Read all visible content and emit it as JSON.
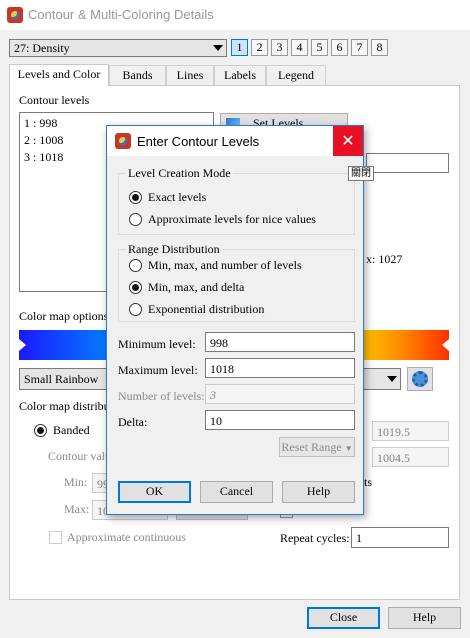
{
  "window": {
    "title": "Contour & Multi-Coloring Details",
    "icon": "tecplot-app-icon"
  },
  "variable_select": {
    "value": "27: Density"
  },
  "frame_buttons": [
    "1",
    "2",
    "3",
    "4",
    "5",
    "6",
    "7",
    "8"
  ],
  "tabs": [
    {
      "label": "Levels and Color"
    },
    {
      "label": "Bands"
    },
    {
      "label": "Lines"
    },
    {
      "label": "Labels"
    },
    {
      "label": "Legend"
    }
  ],
  "levels": {
    "heading": "Contour levels",
    "items": [
      "1 : 998",
      "2 : 1008",
      "3 : 1018"
    ],
    "set_levels_label": "Set Levels...",
    "max_suffix": "x: 1027"
  },
  "colormap": {
    "heading": "Color map options",
    "selected": "Small Rainbow",
    "distribution_heading": "Color map distribution",
    "banded_label": "Banded",
    "contour_values_label": "Contour values",
    "min_label": "Min:",
    "min_value": "99",
    "max_label": "Max:",
    "max_value": "10",
    "right_value_1": "1019.5",
    "right_value_2": "1004.5",
    "approx_continuous_label": "Approximate continuous",
    "repeat_cycles_label": "Repeat cycles:",
    "repeat_cycles_value": "1",
    "right_edge_letters": "ts"
  },
  "footer": {
    "close_label": "Close",
    "help_label": "Help"
  },
  "dialog": {
    "title": "Enter Contour Levels",
    "tooltip": "關閉",
    "mode_group": "Level Creation Mode",
    "mode_options": [
      "Exact levels",
      "Approximate levels for nice values"
    ],
    "range_group": "Range Distribution",
    "range_options": [
      "Min, max, and number of levels",
      "Min, max, and delta",
      "Exponential distribution"
    ],
    "minimum_label": "Minimum level:",
    "minimum_value": "998",
    "maximum_label": "Maximum level:",
    "maximum_value": "1018",
    "number_label": "Number of levels:",
    "number_value": "3",
    "delta_label": "Delta:",
    "delta_value": "10",
    "reset_label": "Reset Range",
    "ok_label": "OK",
    "cancel_label": "Cancel",
    "help_label": "Help"
  }
}
